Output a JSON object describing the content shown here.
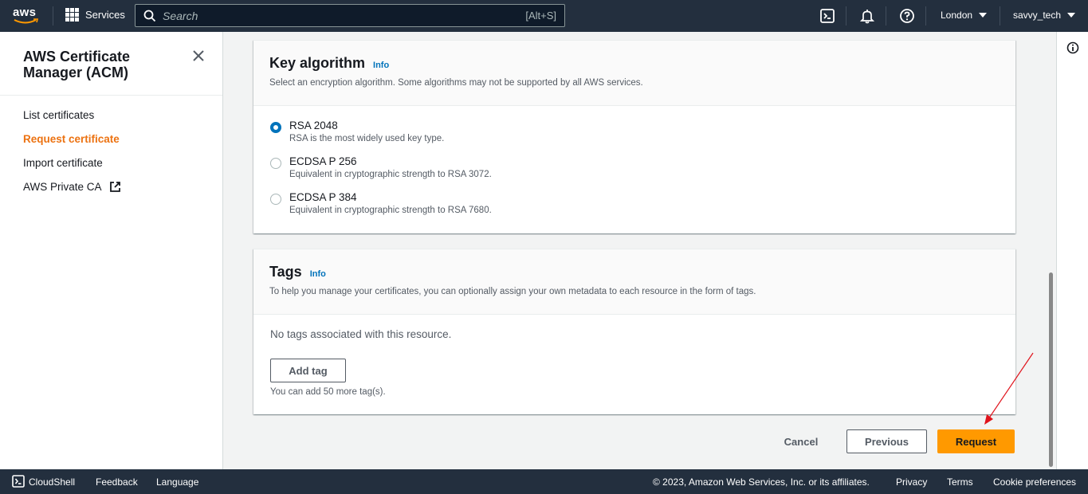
{
  "topbar": {
    "logo_text": "aws",
    "services_label": "Services",
    "search_placeholder": "Search",
    "search_shortcut": "[Alt+S]",
    "region": "London",
    "user": "savvy_tech"
  },
  "sidenav": {
    "title": "AWS Certificate Manager (ACM)",
    "items": [
      {
        "label": "List certificates"
      },
      {
        "label": "Request certificate"
      },
      {
        "label": "Import certificate"
      },
      {
        "label": "AWS Private CA"
      }
    ]
  },
  "key_algorithm": {
    "title": "Key algorithm",
    "info": "Info",
    "description": "Select an encryption algorithm. Some algorithms may not be supported by all AWS services.",
    "options": [
      {
        "title": "RSA 2048",
        "desc": "RSA is the most widely used key type.",
        "selected": true
      },
      {
        "title": "ECDSA P 256",
        "desc": "Equivalent in cryptographic strength to RSA 3072.",
        "selected": false
      },
      {
        "title": "ECDSA P 384",
        "desc": "Equivalent in cryptographic strength to RSA 7680.",
        "selected": false
      }
    ]
  },
  "tags": {
    "title": "Tags",
    "info": "Info",
    "description": "To help you manage your certificates, you can optionally assign your own metadata to each resource in the form of tags.",
    "empty_text": "No tags associated with this resource.",
    "add_tag_label": "Add tag",
    "hint": "You can add 50 more tag(s)."
  },
  "actions": {
    "cancel": "Cancel",
    "previous": "Previous",
    "request": "Request"
  },
  "footer": {
    "cloudshell": "CloudShell",
    "feedback": "Feedback",
    "language": "Language",
    "copyright": "© 2023, Amazon Web Services, Inc. or its affiliates.",
    "privacy": "Privacy",
    "terms": "Terms",
    "cookie": "Cookie preferences"
  },
  "colors": {
    "topbar_bg": "#232f3e",
    "accent_orange": "#ec7211",
    "primary_button": "#ff9900",
    "link_blue": "#0073bb",
    "annotation_red": "#e0121b"
  }
}
